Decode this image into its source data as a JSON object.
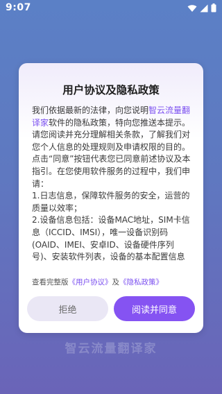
{
  "status_bar": {
    "time": "9:07"
  },
  "background": {
    "app_name": "智云流量翻译家"
  },
  "dialog": {
    "title": "用户协议及隐私政策",
    "body_lead": "我们依据最新的法律，向您说明",
    "body_app_name": "智云流量翻译家",
    "body_rest": "软件的隐私政策，特向您推送本提示。请您阅读并充分理解相关条款，了解我们对您个人信息的处理规则及申请权限的目的。点击“同意”按钮代表您已同意前述协议及本指引。在您使用软件服务的过程中，我们申请：",
    "item_1": "1.日志信息，保障软件服务的安全，运营的质量以效率；",
    "item_2": "2.设备信息包括：设备MAC地址，SIM卡信息（ICCID、IMSI），唯一设备识别码(OAID、IMEI、安卓ID、设备硬件序列号)、安装软件列表，设备的基本配置信息",
    "links": {
      "prefix": "查看完整版",
      "user_agreement": "《用户协议》",
      "and": "及",
      "privacy_policy": "《隐私政策》"
    },
    "reject_label": "拒绝",
    "agree_label": "阅读并同意"
  },
  "colors": {
    "accent": "#7b4ff0",
    "agree_button": "#8553f2",
    "reject_button": "#eae7f5"
  }
}
